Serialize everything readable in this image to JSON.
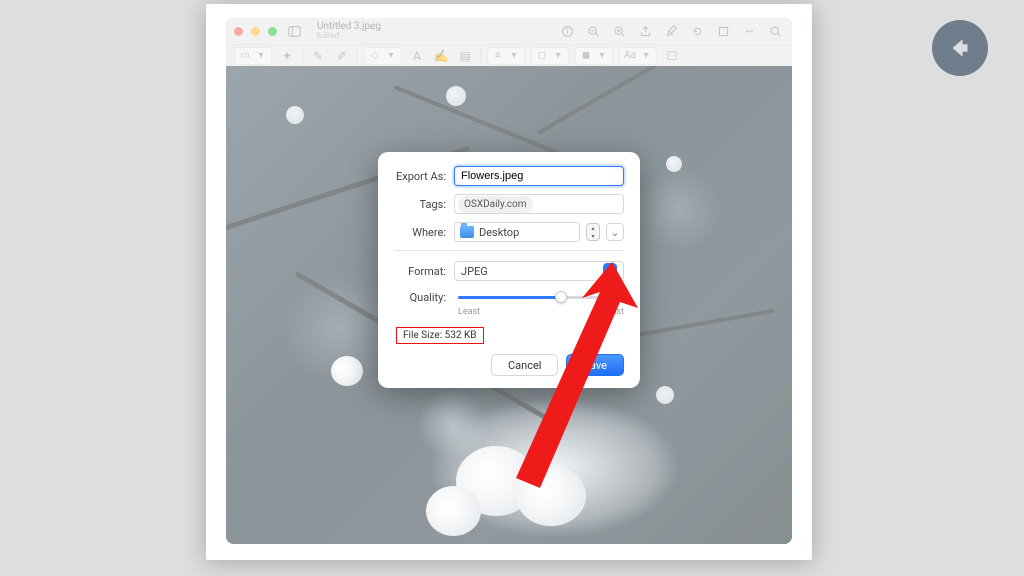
{
  "window": {
    "filename": "Untitled 3.jpeg",
    "status": "Edited"
  },
  "dialog": {
    "export_as_label": "Export As:",
    "export_as_value": "Flowers.jpeg",
    "tags_label": "Tags:",
    "tag_token": "OSXDaily.com",
    "where_label": "Where:",
    "where_value": "Desktop",
    "format_label": "Format:",
    "format_value": "JPEG",
    "quality_label": "Quality:",
    "quality_least": "Least",
    "quality_best": "Best",
    "file_size_label": "File Size:",
    "file_size_value": "532 KB",
    "cancel": "Cancel",
    "save": "Save"
  }
}
